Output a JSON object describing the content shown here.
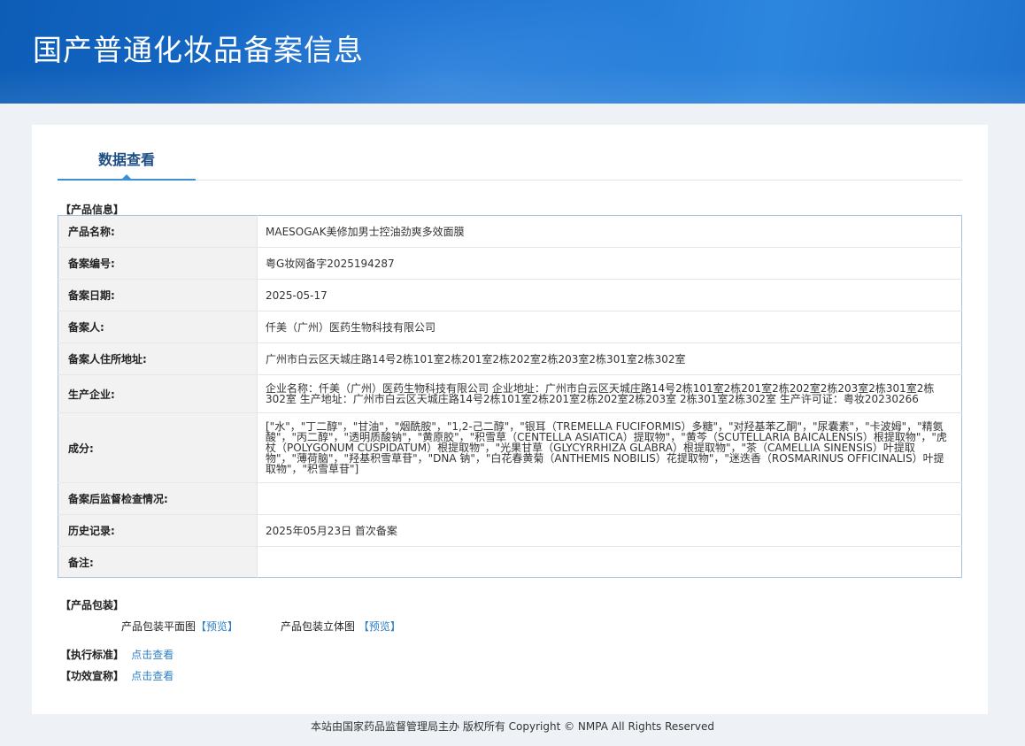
{
  "header": {
    "title": "国产普通化妆品备案信息"
  },
  "tabs": {
    "active_label": "数据查看"
  },
  "sections": {
    "product_info": "【产品信息】",
    "packaging": "【产品包装】",
    "standard": "【执行标准】",
    "efficacy": "【功效宣称】"
  },
  "product": {
    "rows": [
      {
        "label": "产品名称:",
        "value": "MAESOGAK美修加男士控油劲爽多效面膜"
      },
      {
        "label": "备案编号:",
        "value": "粤G妆网备字2025194287"
      },
      {
        "label": "备案日期:",
        "value": "2025-05-17"
      },
      {
        "label": "备案人:",
        "value": "仟美（广州）医药生物科技有限公司"
      },
      {
        "label": "备案人住所地址:",
        "value": "广州市白云区天城庄路14号2栋101室2栋201室2栋202室2栋203室2栋301室2栋302室"
      },
      {
        "label": "生产企业:",
        "value": "企业名称：仟美（广州）医药生物科技有限公司 企业地址：广州市白云区天城庄路14号2栋101室2栋201室2栋202室2栋203室2栋301室2栋302室 生产地址：广州市白云区天城庄路14号2栋101室2栋201室2栋202室2栋203室 2栋301室2栋302室 生产许可证：粤妆20230266"
      },
      {
        "label": "成分:",
        "value": "[\"水\"，\"丁二醇\"，\"甘油\"，\"烟酰胺\"，\"1,2-己二醇\"，\"银耳（TREMELLA FUCIFORMIS）多糖\"，\"对羟基苯乙酮\"，\"尿囊素\"，\"卡波姆\"，\"精氨酸\"，\"丙二醇\"，\"透明质酸钠\"，\"黄原胶\"，\"积雪草（CENTELLA ASIATICA）提取物\"，\"黄芩（SCUTELLARIA BAICALENSIS）根提取物\"，\"虎杖（POLYGONUM CUSPIDATUM）根提取物\"，\"光果甘草（GLYCYRRHIZA GLABRA）根提取物\"，\"茶（CAMELLIA SINENSIS）叶提取物\"，\"薄荷脑\"，\"羟基积雪草苷\"，\"DNA 钠\"，\"白花春黄菊（ANTHEMIS NOBILIS）花提取物\"，\"迷迭香（ROSMARINUS OFFICINALIS）叶提取物\"，\"积雪草苷\"]"
      },
      {
        "label": "备案后监督检查情况:",
        "value": ""
      },
      {
        "label": "历史记录:",
        "value": "2025年05月23日 首次备案"
      },
      {
        "label": "备注:",
        "value": ""
      }
    ]
  },
  "packaging": {
    "flat_label": "产品包装平面图",
    "flat_link": "【预览】",
    "solid_label": "产品包装立体图",
    "solid_link": "【预览】"
  },
  "links": {
    "standard": "点击查看",
    "efficacy": "点击查看"
  },
  "footer": {
    "text": "本站由国家药品监督管理局主办 版权所有 Copyright © NMPA All Rights Reserved"
  }
}
